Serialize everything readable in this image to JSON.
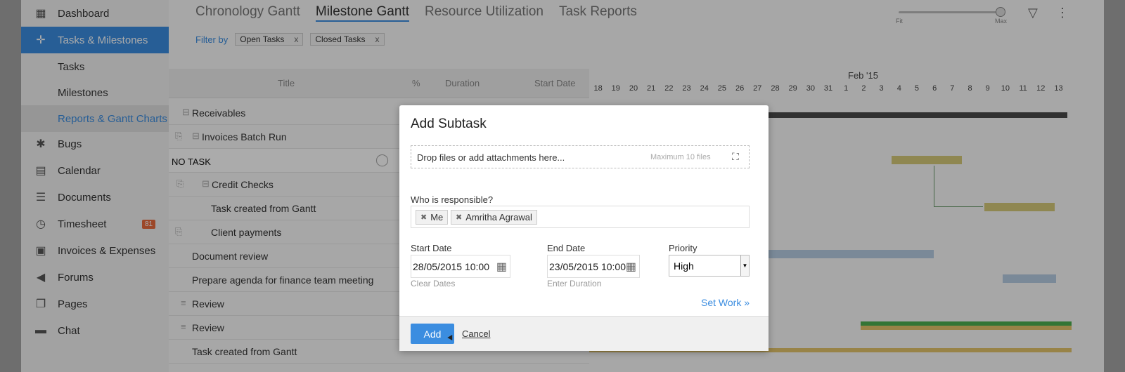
{
  "sidebar": {
    "items": [
      {
        "label": "Dashboard",
        "icon": "dashboard-icon"
      },
      {
        "label": "Tasks & Milestones",
        "icon": "tasks-icon"
      },
      {
        "label": "Tasks"
      },
      {
        "label": "Milestones"
      },
      {
        "label": "Reports & Gantt Charts"
      },
      {
        "label": "Bugs",
        "icon": "bug-icon"
      },
      {
        "label": "Calendar",
        "icon": "calendar-icon"
      },
      {
        "label": "Documents",
        "icon": "documents-icon"
      },
      {
        "label": "Timesheet",
        "icon": "timesheet-icon",
        "badge": "81"
      },
      {
        "label": "Invoices & Expenses",
        "icon": "invoices-icon"
      },
      {
        "label": "Forums",
        "icon": "forums-icon"
      },
      {
        "label": "Pages",
        "icon": "pages-icon"
      },
      {
        "label": "Chat",
        "icon": "chat-icon"
      }
    ]
  },
  "tabs": [
    "Chronology Gantt",
    "Milestone Gantt",
    "Resource Utilization",
    "Task Reports"
  ],
  "filter": {
    "label": "Filter by",
    "chips": [
      "Open Tasks",
      "Closed Tasks"
    ],
    "remove": "x"
  },
  "zoom": {
    "fit": "Fit",
    "max": "Max",
    "level": 1.0
  },
  "grid": {
    "columns": [
      "Title",
      "%",
      "Duration",
      "Start Date"
    ],
    "rows": [
      "Receivables",
      "Invoices Batch Run",
      "NO TASK",
      "Credit Checks",
      "Task created from Gantt",
      "Client payments",
      "Document review",
      "Prepare agenda for finance team meeting",
      "Review",
      "Review",
      "Task created from Gantt"
    ]
  },
  "gantt": {
    "month": "Feb '15",
    "days": [
      "18",
      "19",
      "20",
      "21",
      "22",
      "23",
      "24",
      "25",
      "26",
      "27",
      "28",
      "29",
      "30",
      "31",
      "1",
      "2",
      "3",
      "4",
      "5",
      "6",
      "7",
      "8",
      "9",
      "10",
      "11",
      "12",
      "13"
    ]
  },
  "dialog": {
    "title": "Add Subtask",
    "drop_text": "Drop files or add attachments here...",
    "drop_limit": "Maximum 10 files",
    "responsible_label": "Who is responsible?",
    "assignees": [
      "Me",
      "Amritha Agrawal"
    ],
    "start_label": "Start Date",
    "start_value": "28/05/2015 10:00",
    "clear_dates": "Clear Dates",
    "end_label": "End Date",
    "end_value": "23/05/2015 10:00",
    "enter_duration": "Enter Duration",
    "priority_label": "Priority",
    "priority_value": "High",
    "set_work": "Set Work »",
    "add": "Add",
    "cancel": "Cancel"
  }
}
